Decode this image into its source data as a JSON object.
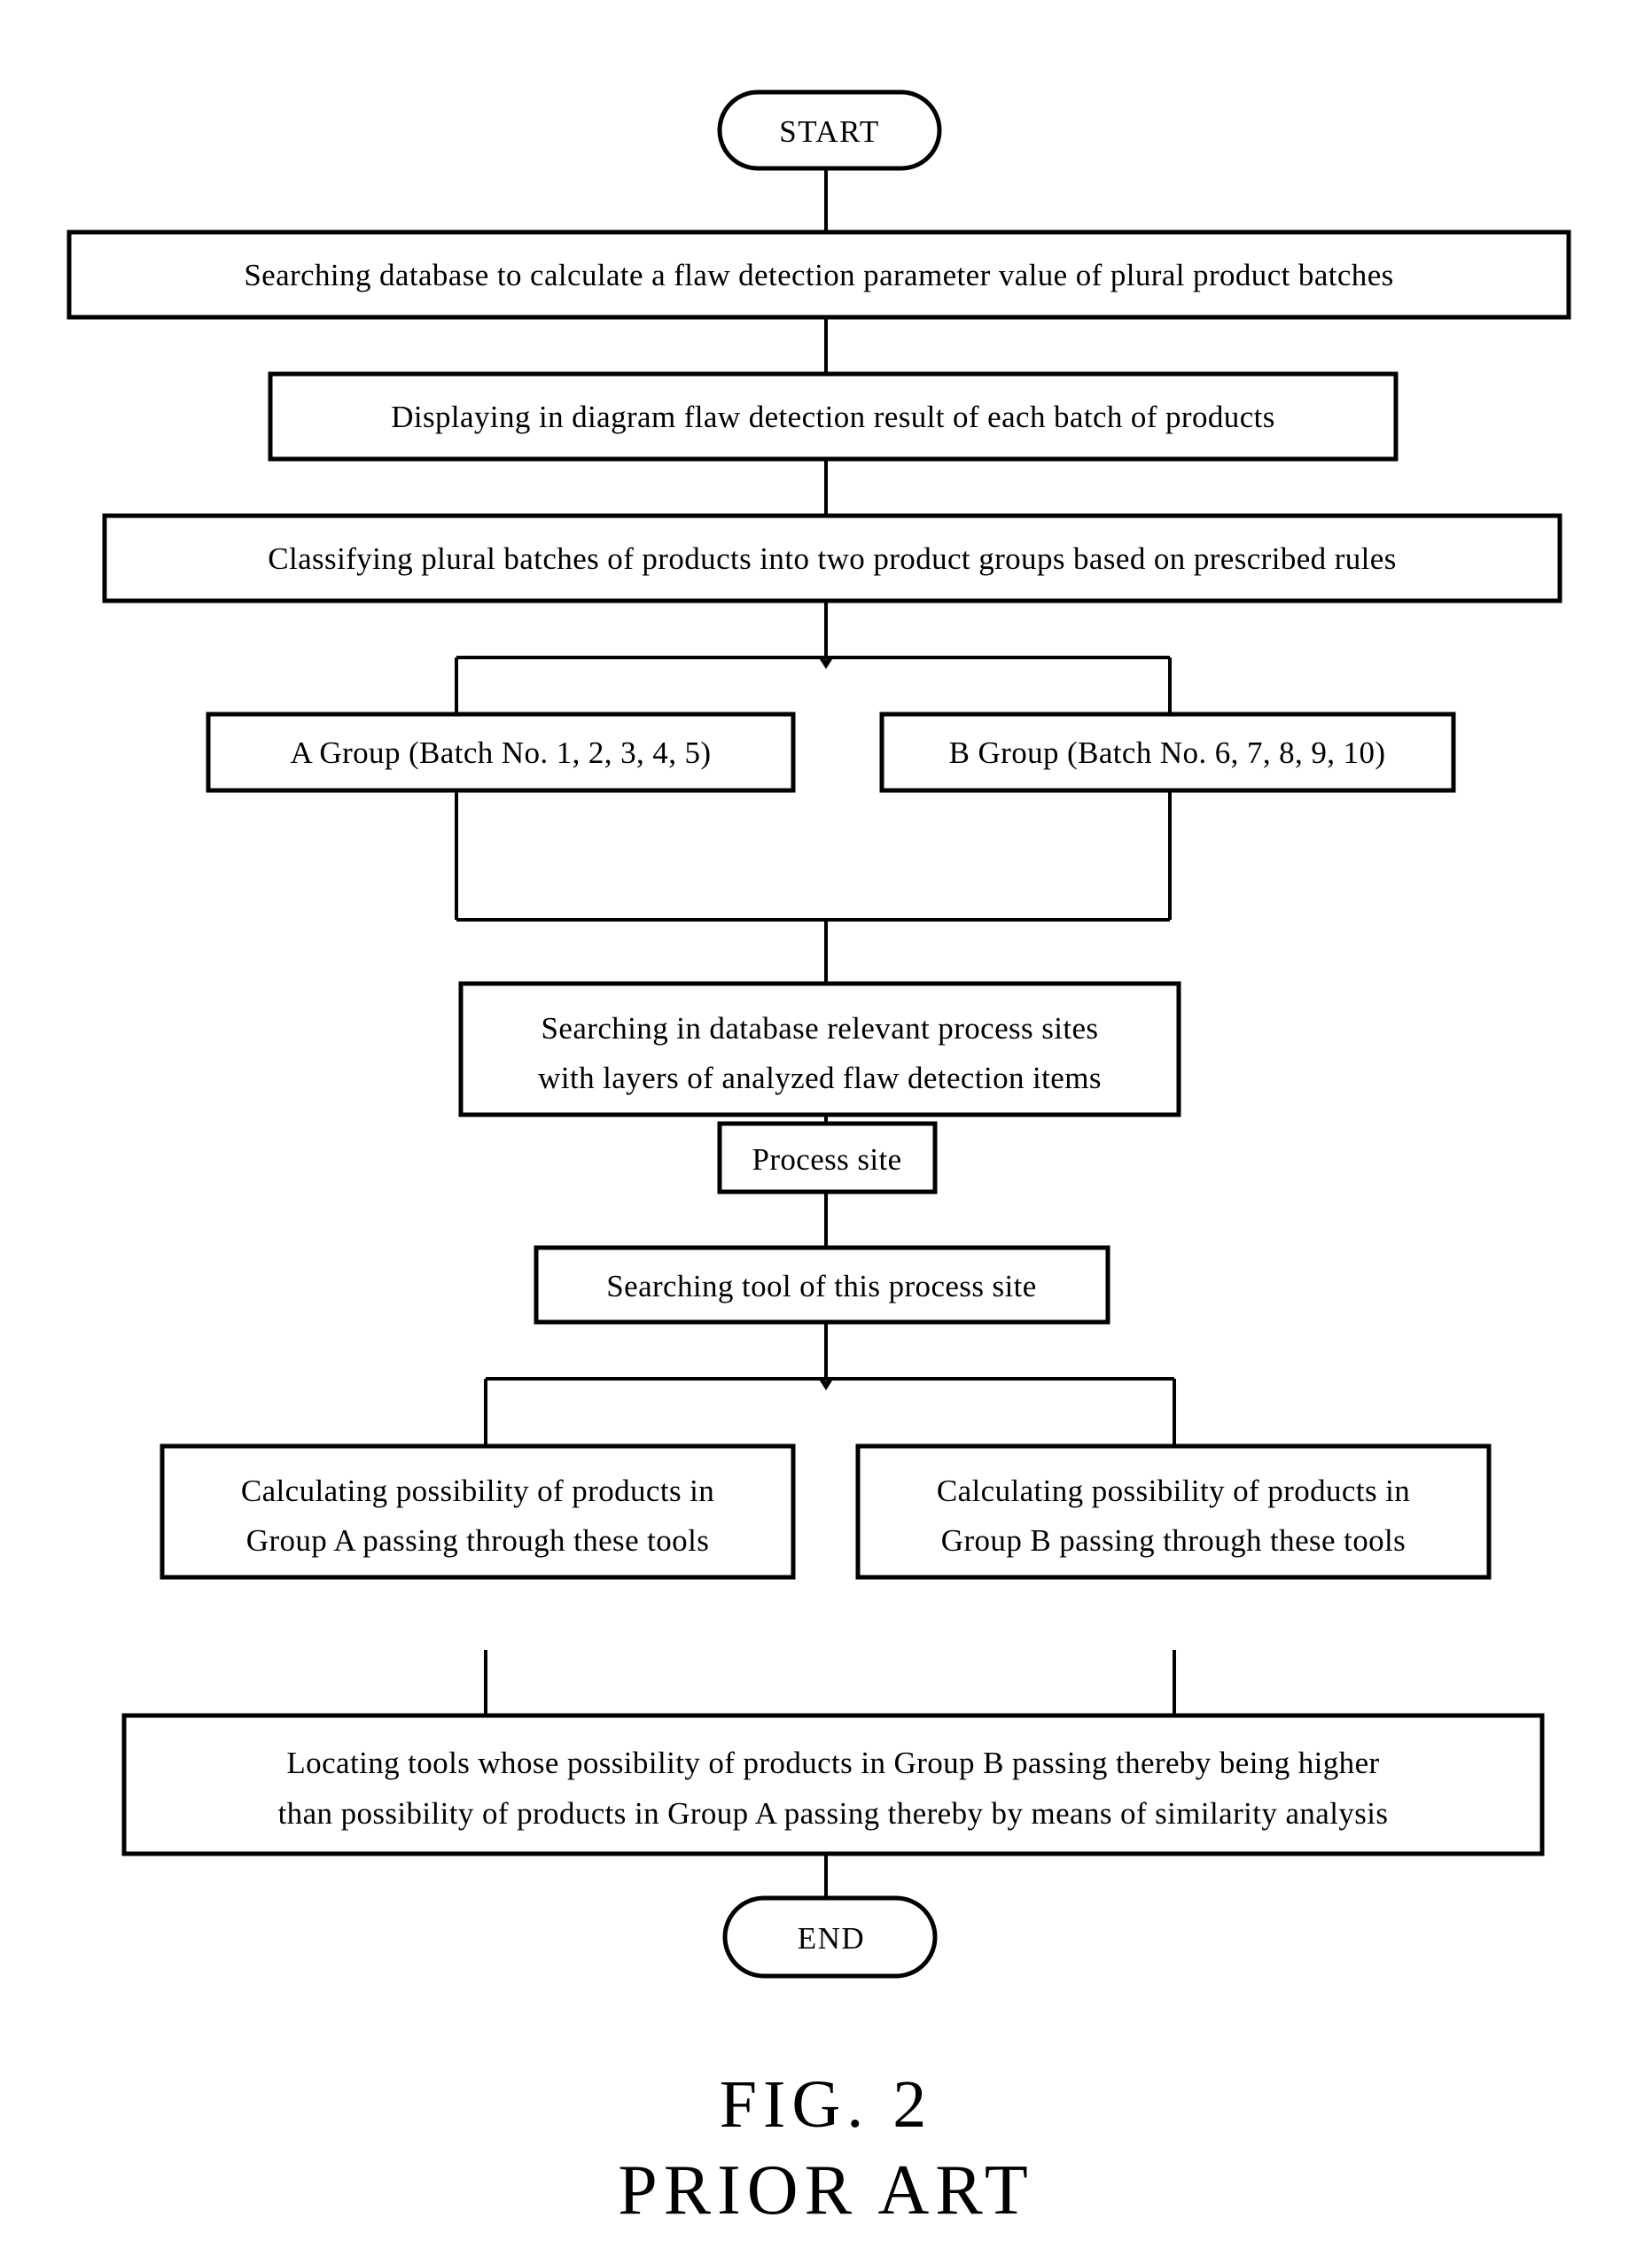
{
  "figure": {
    "caption_line1": "FIG. 2",
    "caption_line2": "PRIOR ART"
  },
  "flowchart": {
    "type": "process-flow-diagram",
    "orientation": "top-to-bottom",
    "stroke_color": "#000000",
    "background_color": "#ffffff",
    "nodes": [
      {
        "id": "start",
        "shape": "terminator",
        "label": "START"
      },
      {
        "id": "search-db",
        "shape": "process",
        "label": "Searching database to calculate a flaw detection parameter value of plural product batches"
      },
      {
        "id": "display-diagram",
        "shape": "process",
        "label": "Displaying in diagram flaw detection result of each batch of products"
      },
      {
        "id": "classify",
        "shape": "process",
        "label": "Classifying plural batches of products into two product groups based on prescribed rules"
      },
      {
        "id": "group-a",
        "shape": "process",
        "label": "A Group (Batch No. 1, 2, 3, 4, 5)"
      },
      {
        "id": "group-b",
        "shape": "process",
        "label": "B Group (Batch No. 6, 7, 8, 9, 10)"
      },
      {
        "id": "search-process-sites",
        "shape": "process",
        "label_line1": "Searching in database relevant process sites",
        "label_line2": "with layers of analyzed flaw detection items"
      },
      {
        "id": "process-site",
        "shape": "process",
        "label": "Process site"
      },
      {
        "id": "search-tool",
        "shape": "process",
        "label": "Searching tool of this process site"
      },
      {
        "id": "calc-a",
        "shape": "process",
        "label_line1": "Calculating possibility of products in",
        "label_line2": "Group A passing through these tools"
      },
      {
        "id": "calc-b",
        "shape": "process",
        "label_line1": "Calculating possibility of products in",
        "label_line2": "Group B passing through these tools"
      },
      {
        "id": "locate-tools",
        "shape": "process",
        "label_line1": "Locating tools whose possibility of products in Group B passing thereby being higher",
        "label_line2": "than possibility of products in Group A passing thereby by means of similarity analysis"
      },
      {
        "id": "end",
        "shape": "terminator",
        "label": "END"
      }
    ],
    "edges": [
      {
        "from": "start",
        "to": "search-db",
        "style": "straight-arrow"
      },
      {
        "from": "search-db",
        "to": "display-diagram",
        "style": "straight-arrow"
      },
      {
        "from": "display-diagram",
        "to": "classify",
        "style": "straight-arrow"
      },
      {
        "from": "classify",
        "to": "group-a",
        "style": "split-branch-left"
      },
      {
        "from": "classify",
        "to": "group-b",
        "style": "split-branch-right"
      },
      {
        "from": "group-a",
        "to": "search-process-sites",
        "style": "merge-branch-left"
      },
      {
        "from": "group-b",
        "to": "search-process-sites",
        "style": "merge-branch-right"
      },
      {
        "from": "search-process-sites",
        "to": "process-site",
        "style": "straight-arrow"
      },
      {
        "from": "process-site",
        "to": "search-tool",
        "style": "straight-arrow"
      },
      {
        "from": "search-tool",
        "to": "calc-a",
        "style": "split-branch-left"
      },
      {
        "from": "search-tool",
        "to": "calc-b",
        "style": "split-branch-right"
      },
      {
        "from": "calc-a",
        "to": "locate-tools",
        "style": "merge-branch-left"
      },
      {
        "from": "calc-b",
        "to": "locate-tools",
        "style": "merge-branch-right"
      },
      {
        "from": "locate-tools",
        "to": "end",
        "style": "straight-arrow"
      }
    ]
  }
}
